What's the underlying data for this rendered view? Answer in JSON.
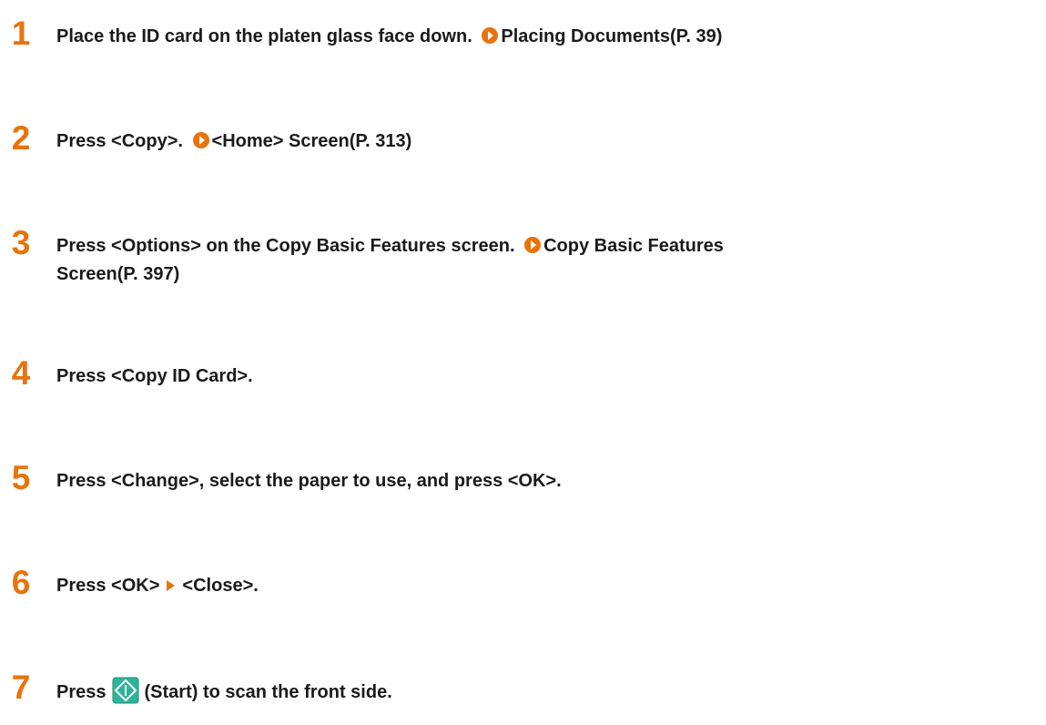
{
  "steps": [
    {
      "number": "1",
      "text": "Place the ID card on the platen glass face down.",
      "link": "Placing Documents(P. 39)"
    },
    {
      "number": "2",
      "text": "Press <Copy>.",
      "link": "<Home> Screen(P. 313)"
    },
    {
      "number": "3",
      "text": "Press <Options> on the Copy Basic Features screen.",
      "link_line1": "Copy Basic Features",
      "link_line2": "Screen(P. 397)"
    },
    {
      "number": "4",
      "text": "Press <Copy ID Card>."
    },
    {
      "number": "5",
      "text": "Press <Change>, select the paper to use, and press <OK>."
    },
    {
      "number": "6",
      "text_before": "Press <OK>",
      "text_after": "<Close>."
    },
    {
      "number": "7",
      "text_before": "Press",
      "text_after": "(Start) to scan the front side."
    }
  ],
  "icons": {
    "link_color": "#e8730c",
    "start_icon": "start-key-icon",
    "start_color": "#2fb39a"
  }
}
